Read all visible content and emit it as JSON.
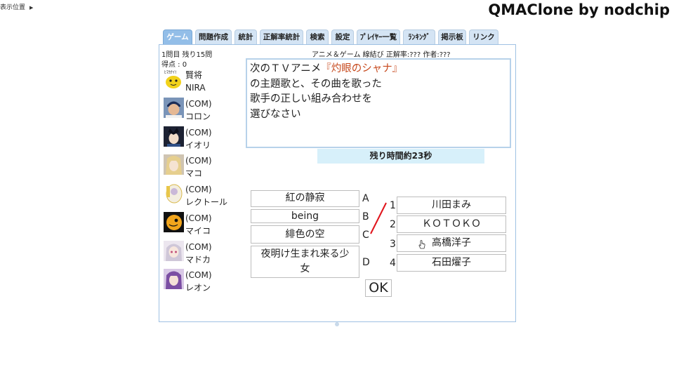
{
  "corner": {
    "label": "表示位置"
  },
  "brand": "QMAClone by nodchip",
  "tabs": [
    "ゲーム",
    "問題作成",
    "統計",
    "正解率統計",
    "検索",
    "設定",
    "ﾌﾟﾚｲﾔｰ一覧",
    "ﾗﾝｷﾝｸﾞ",
    "掲示板",
    "リンク"
  ],
  "active_tab": "ゲーム",
  "status": {
    "progress": "1問目 残り15問",
    "score": "得点 : 0",
    "info": "アニメ＆ゲーム 線結び 正解率:??? 作者:???"
  },
  "players": [
    {
      "line1": "賢将",
      "line2": "NIRA",
      "icon": "yellow-mascot-avatar-icon"
    },
    {
      "line1": "(COM)",
      "line2": "コロン",
      "icon": "baseball-player-avatar-icon"
    },
    {
      "line1": "(COM)",
      "line2": "イオリ",
      "icon": "dark-hair-character-avatar-icon"
    },
    {
      "line1": "(COM)",
      "line2": "マコ",
      "icon": "blonde-character-avatar-icon"
    },
    {
      "line1": "(COM)",
      "line2": "レクトール",
      "icon": "sticker-character-avatar-icon"
    },
    {
      "line1": "(COM)",
      "line2": "マイコ",
      "icon": "orange-blob-avatar-icon"
    },
    {
      "line1": "(COM)",
      "line2": "マドカ",
      "icon": "silver-hair-character-avatar-icon"
    },
    {
      "line1": "(COM)",
      "line2": "レオン",
      "icon": "purple-hair-character-avatar-icon"
    }
  ],
  "question": {
    "line1_pre": "次のＴＶアニメ",
    "line1_title": "『灼眼のシャナ』",
    "line2": "の主題歌と、その曲を歌った",
    "line3": "歌手の正しい組み合わせを",
    "line4": "選びなさい",
    "highlight_color": "#c74a1e"
  },
  "timer": "残り時間約23秒",
  "left_items": [
    {
      "letter": "A",
      "text": "紅の静寂"
    },
    {
      "letter": "B",
      "text": "being"
    },
    {
      "letter": "C",
      "text": "緋色の空"
    },
    {
      "letter": "D",
      "text": "夜明け生まれ来る少女"
    }
  ],
  "right_items": [
    {
      "num": "1",
      "text": "川田まみ"
    },
    {
      "num": "2",
      "text": "ＫＯＴＯＫＯ"
    },
    {
      "num": "3",
      "text": "高橋洋子"
    },
    {
      "num": "4",
      "text": "石田燿子"
    }
  ],
  "connection": {
    "from": "C",
    "to": "1",
    "color": "#e0141c"
  },
  "ok_label": "OK"
}
